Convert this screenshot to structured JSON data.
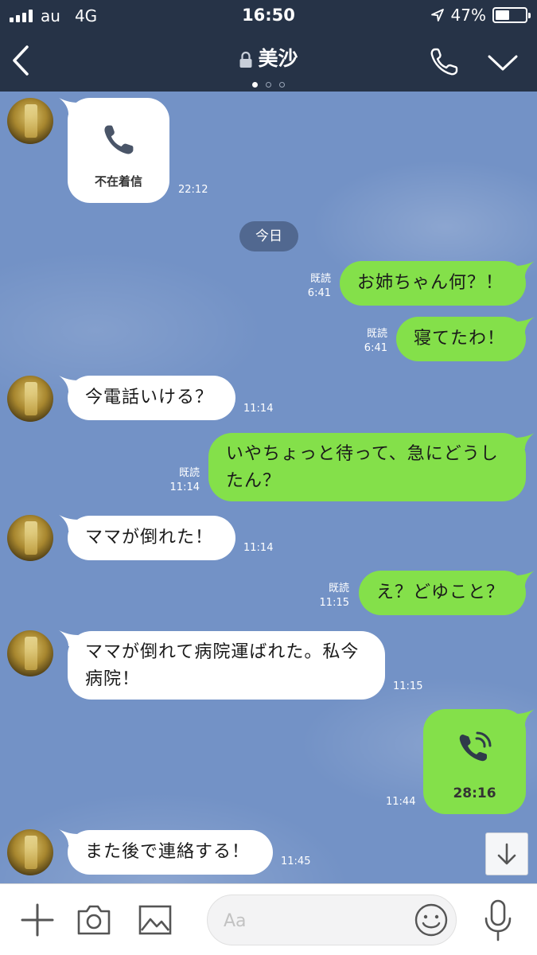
{
  "status_bar": {
    "carrier": "au",
    "network": "4G",
    "time": "16:50",
    "battery": "47%",
    "battery_level": 0.47
  },
  "header": {
    "title": "美沙",
    "page_count": 3,
    "active_page": 1
  },
  "chat": {
    "background_color": "#7392c6",
    "missed_call": {
      "label": "不在着信",
      "time": "22:12"
    },
    "date_divider": "今日",
    "messages": [
      {
        "side": "out",
        "text": "お姉ちゃん何？！",
        "read": "既読",
        "time": "6:41"
      },
      {
        "side": "out",
        "text": "寝てたわ！",
        "read": "既読",
        "time": "6:41"
      },
      {
        "side": "in",
        "text": "今電話いける？",
        "time": "11:14"
      },
      {
        "side": "out",
        "lines": [
          "いやちょっと待って、急にどうし",
          "たん？"
        ],
        "read": "既読",
        "time": "11:14"
      },
      {
        "side": "in",
        "text": "ママが倒れた！",
        "time": "11:14"
      },
      {
        "side": "out",
        "text": "え？どゆこと？",
        "read": "既読",
        "time": "11:15"
      },
      {
        "side": "in",
        "lines": [
          "ママが倒れて病院運ばれた。私今",
          "病院！"
        ],
        "time": "11:15"
      },
      {
        "side": "in",
        "text": "また後で連絡する！",
        "time": "11:45"
      }
    ],
    "outgoing_call": {
      "duration": "28:16",
      "time": "11:44"
    }
  },
  "input_bar": {
    "placeholder": "Aa"
  },
  "colors": {
    "header_bg": "#263347",
    "bubble_out": "#84e04a",
    "bubble_in": "#ffffff"
  }
}
